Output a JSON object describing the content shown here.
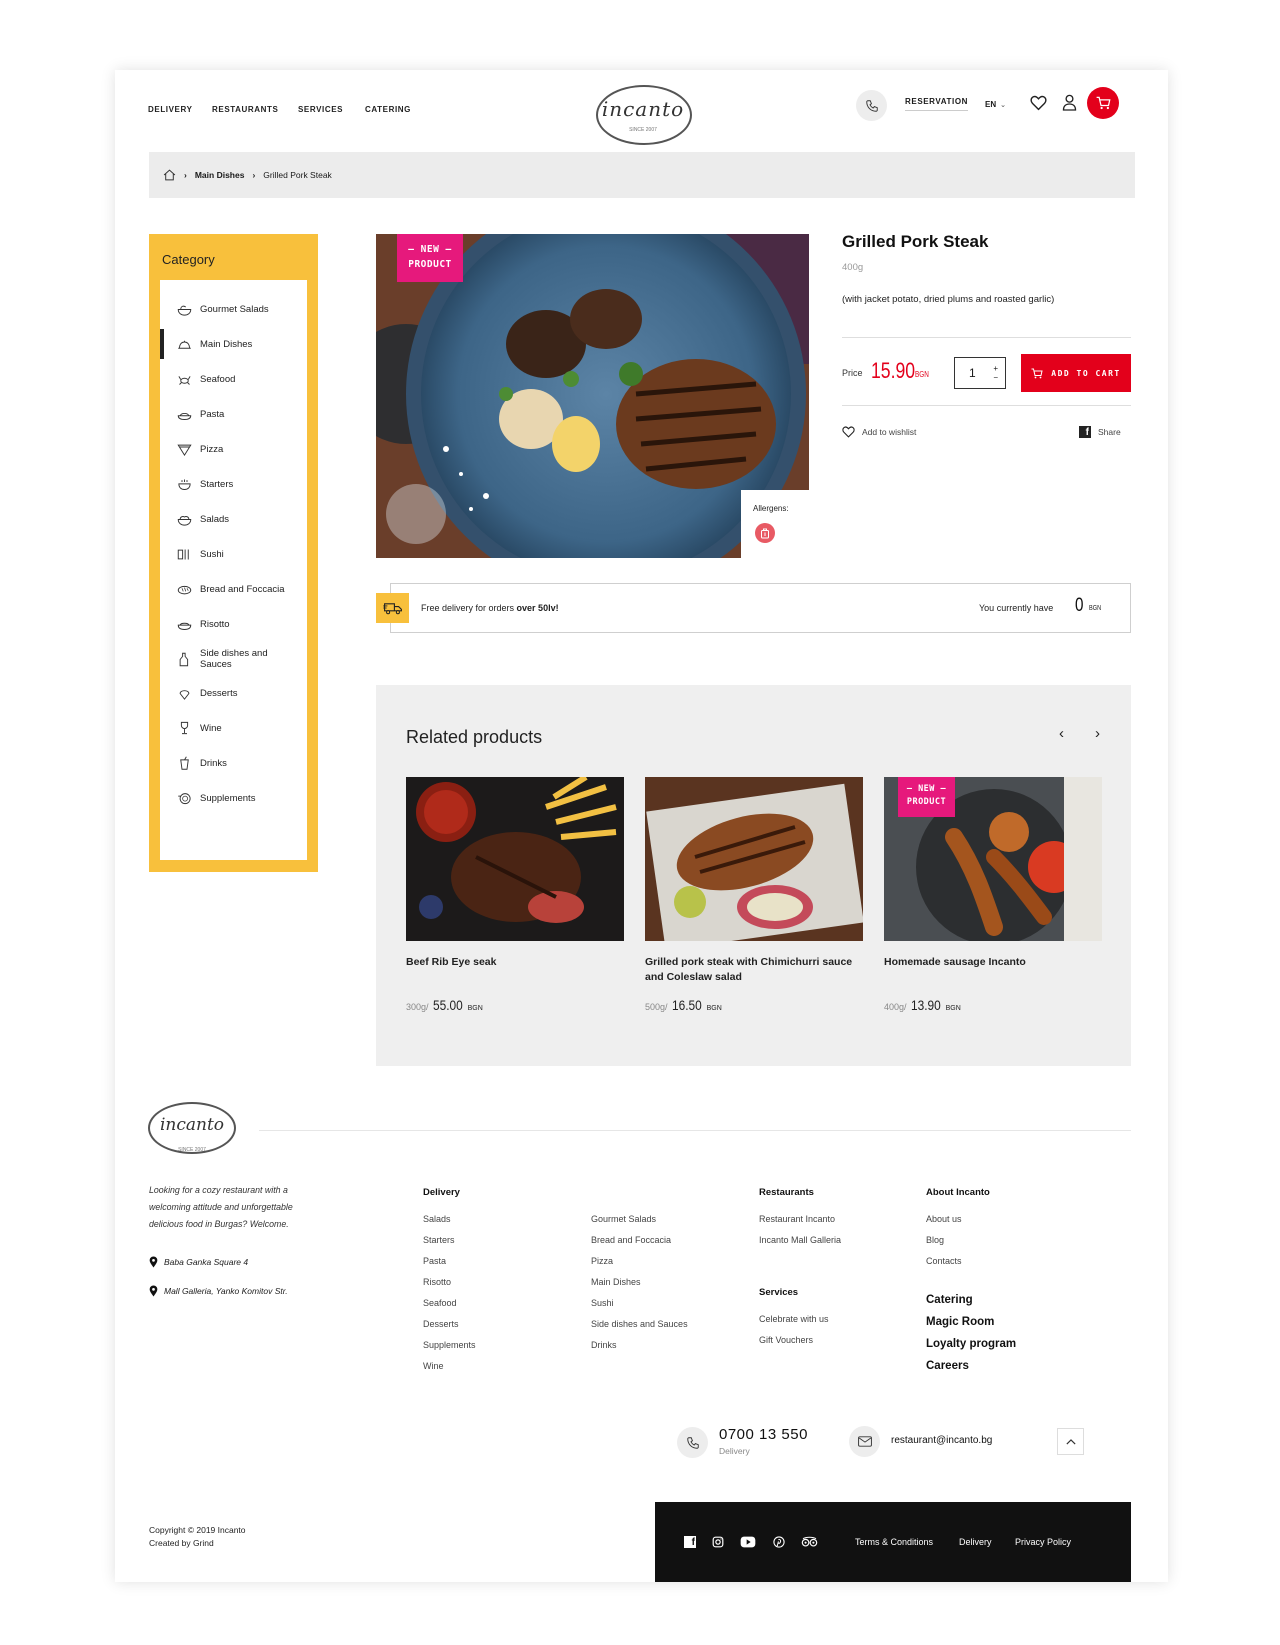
{
  "nav": {
    "items": [
      "DELIVERY",
      "RESTAURANTS",
      "SERVICES",
      "CATERING"
    ],
    "logo_text": "incanto",
    "logo_since": "SINCE 2007",
    "reservation": "RESERVATION",
    "language": "EN"
  },
  "breadcrumb": {
    "items": [
      "Main Dishes",
      "Grilled Pork Steak"
    ],
    "separator": "›"
  },
  "sidebar": {
    "title": "Category",
    "items": [
      {
        "label": "Gourmet Salads",
        "icon": "salad-bowl-icon"
      },
      {
        "label": "Main Dishes",
        "icon": "cloche-icon",
        "active": true
      },
      {
        "label": "Seafood",
        "icon": "crab-icon"
      },
      {
        "label": "Pasta",
        "icon": "pasta-icon"
      },
      {
        "label": "Pizza",
        "icon": "pizza-slice-icon"
      },
      {
        "label": "Starters",
        "icon": "bowl-icon"
      },
      {
        "label": "Salads",
        "icon": "salad-icon"
      },
      {
        "label": "Sushi",
        "icon": "sushi-icon"
      },
      {
        "label": "Bread and Foccacia",
        "icon": "bread-icon"
      },
      {
        "label": "Risotto",
        "icon": "risotto-icon"
      },
      {
        "label": "Side dishes and Sauces",
        "icon": "sauce-bottle-icon"
      },
      {
        "label": "Desserts",
        "icon": "ice-cream-icon"
      },
      {
        "label": "Wine",
        "icon": "wine-glass-icon"
      },
      {
        "label": "Drinks",
        "icon": "drink-cup-icon"
      },
      {
        "label": "Supplements",
        "icon": "supplements-icon"
      }
    ]
  },
  "product": {
    "badge_line1": "— NEW —",
    "badge_line2": "PRODUCT",
    "title": "Grilled Pork Steak",
    "weight": "400g",
    "description": "(with jacket potato, dried plums and roasted garlic)",
    "price_label": "Price",
    "price": "15.90",
    "currency": "BGN",
    "quantity": "1",
    "add_to_cart": "ADD TO CART",
    "wishlist": "Add to wishlist",
    "share": "Share",
    "allergens_label": "Allergens:"
  },
  "delivery_bar": {
    "text_prefix": "Free delivery for orders ",
    "text_bold": "over 50lv!",
    "current_label": "You currently have",
    "current_value": "0",
    "currency": "BGN"
  },
  "related": {
    "title": "Related products",
    "items": [
      {
        "name": "Beef Rib Eye seak",
        "weight": "300g/",
        "price": "55.00",
        "currency": "BGN",
        "new": false
      },
      {
        "name": "Grilled pork steak with Chimichurri sauce and Coleslaw salad",
        "weight": "500g/",
        "price": "16.50",
        "currency": "BGN",
        "new": false
      },
      {
        "name": "Homemade sausage Incanto",
        "weight": "400g/",
        "price": "13.90",
        "currency": "BGN",
        "new": true
      }
    ]
  },
  "footer": {
    "description": "Looking for a cozy restaurant with a welcoming attitude and unforgettable delicious food in Burgas? Welcome.",
    "addresses": [
      "Baba Ganka Square 4",
      "Mall Galleria, Yanko Komitov Str."
    ],
    "delivery_head": "Delivery",
    "delivery_col1": [
      "Salads",
      "Starters",
      "Pasta",
      "Risotto",
      "Seafood",
      "Desserts",
      "Supplements",
      "Wine"
    ],
    "delivery_col2": [
      "Gourmet Salads",
      "Bread and Foccacia",
      "Pizza",
      "Main Dishes",
      "Sushi",
      "Side dishes and Sauces",
      "Drinks"
    ],
    "restaurants_head": "Restaurants",
    "restaurants": [
      "Restaurant Incanto",
      "Incanto Mall Galleria"
    ],
    "services_head": "Services",
    "services": [
      "Celebrate with us",
      "Gift Vouchers"
    ],
    "about_head": "About Incanto",
    "about": [
      "About us",
      "Blog",
      "Contacts"
    ],
    "about_big": [
      "Catering",
      "Magic Room",
      "Loyalty program",
      "Careers"
    ],
    "phone": "0700 13 550",
    "phone_label": "Delivery",
    "email": "restaurant@incanto.bg",
    "copyright": "Copyright © 2019 Incanto",
    "created_by": "Created by Grind",
    "bottom_links": [
      "Terms & Conditions",
      "Delivery",
      "Privacy Policy"
    ]
  },
  "colors": {
    "accent_red": "#e3001b",
    "sidebar_yellow": "#f8c03c",
    "badge_pink": "#e6197c",
    "footer_dark": "#111111"
  }
}
